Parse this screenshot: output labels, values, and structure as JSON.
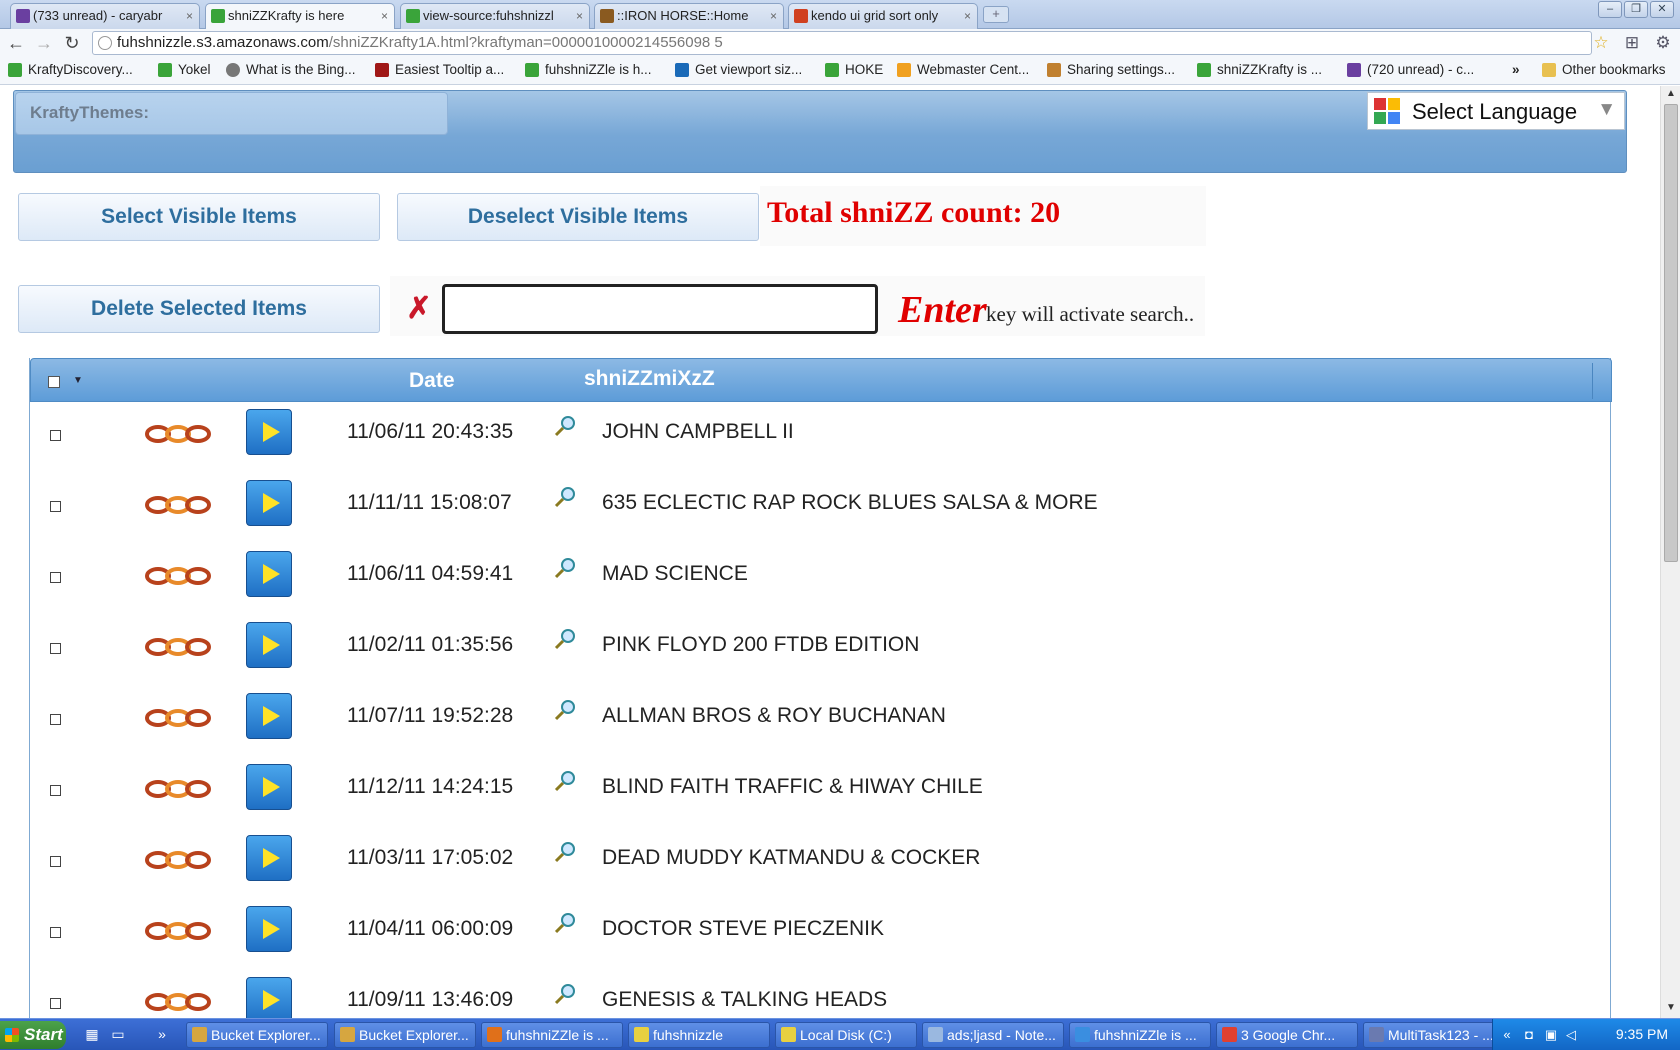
{
  "browser": {
    "tabs": [
      {
        "label": "(733 unread) - caryabr",
        "icon_color": "#6a3fa0",
        "active": false
      },
      {
        "label": "shniZZKrafty is here",
        "icon_color": "#3aa43a",
        "active": true
      },
      {
        "label": "view-source:fuhshnizzl",
        "icon_color": "#3aa43a",
        "active": false
      },
      {
        "label": "::IRON HORSE::Home",
        "icon_color": "#8a5a20",
        "active": false
      },
      {
        "label": "kendo ui grid sort only",
        "icon_color": "#d04020",
        "active": false
      }
    ],
    "tab_close_glyph": "×",
    "new_tab_glyph": "+",
    "url_host": "fuhshnizzle.s3.amazonaws.com",
    "url_path": "/shniZZKrafty1A.html?kraftyman=0000010000214556098 5",
    "bookmarks": [
      {
        "label": "KraftyDiscovery...",
        "icon_color": "#3aa43a"
      },
      {
        "label": "Yokel",
        "icon_color": "#3aa43a"
      },
      {
        "label": "What is the Bing...",
        "icon_color": "#777777"
      },
      {
        "label": "Easiest Tooltip a...",
        "icon_color": "#a01818"
      },
      {
        "label": "fuhshniZZle is h...",
        "icon_color": "#3aa43a"
      },
      {
        "label": "Get viewport siz...",
        "icon_color": "#1a6ab8"
      },
      {
        "label": "HOKE",
        "icon_color": "#3aa43a"
      },
      {
        "label": "Webmaster Cent...",
        "icon_color": "#f0a020"
      },
      {
        "label": "Sharing settings...",
        "icon_color": "#c08030"
      },
      {
        "label": "shniZZKrafty is ...",
        "icon_color": "#3aa43a"
      },
      {
        "label": "(720 unread) - c...",
        "icon_color": "#6a3fa0"
      }
    ],
    "bookmarks_overflow": "»",
    "other_bookmarks": "Other bookmarks"
  },
  "page": {
    "themes_label": "KraftyThemes:",
    "language_select": "Select Language",
    "select_visible_label": "Select Visible Items",
    "deselect_visible_label": "Deselect Visible Items",
    "total_count_label": "Total shniZZ count: 20",
    "delete_selected_label": "Delete Selected Items",
    "search_value": "",
    "enter_word": "Enter",
    "enter_hint": "key will activate search..",
    "grid": {
      "columns": [
        "Date",
        "shniZZmiXzZ"
      ],
      "rows": [
        {
          "date": "11/06/11 20:43:35",
          "title": "JOHN CAMPBELL II"
        },
        {
          "date": "11/11/11 15:08:07",
          "title": "635 ECLECTIC RAP ROCK BLUES SALSA & MORE"
        },
        {
          "date": "11/06/11 04:59:41",
          "title": "MAD SCIENCE"
        },
        {
          "date": "11/02/11 01:35:56",
          "title": "PINK FLOYD 200 FTDB EDITION"
        },
        {
          "date": "11/07/11 19:52:28",
          "title": "ALLMAN BROS & ROY BUCHANAN"
        },
        {
          "date": "11/12/11 14:24:15",
          "title": "BLIND FAITH TRAFFIC & HIWAY CHILE"
        },
        {
          "date": "11/03/11 17:05:02",
          "title": "DEAD MUDDY KATMANDU & COCKER"
        },
        {
          "date": "11/04/11 06:00:09",
          "title": "DOCTOR STEVE PIECZENIK"
        },
        {
          "date": "11/09/11 13:46:09",
          "title": "GENESIS & TALKING HEADS"
        }
      ]
    }
  },
  "taskbar": {
    "start_label": "Start",
    "tasks": [
      {
        "label": "Bucket Explorer...",
        "icon_color": "#d6a640"
      },
      {
        "label": "Bucket Explorer...",
        "icon_color": "#d6a640"
      },
      {
        "label": "fuhshniZZle is ...",
        "icon_color": "#e0701a"
      },
      {
        "label": "fuhshnizzle",
        "icon_color": "#e8d040"
      },
      {
        "label": "Local Disk (C:)",
        "icon_color": "#e8d040"
      },
      {
        "label": "ads;ljasd - Note...",
        "icon_color": "#9ab8e0"
      },
      {
        "label": "fuhshniZZle is ...",
        "icon_color": "#3a8ee0"
      },
      {
        "label": "3 Google Chr...",
        "icon_color": "#e04030"
      },
      {
        "label": "MultiTask123 - ...",
        "icon_color": "#6a7ab0"
      }
    ],
    "tray_chevron": "«",
    "clock": "9:35 PM"
  }
}
